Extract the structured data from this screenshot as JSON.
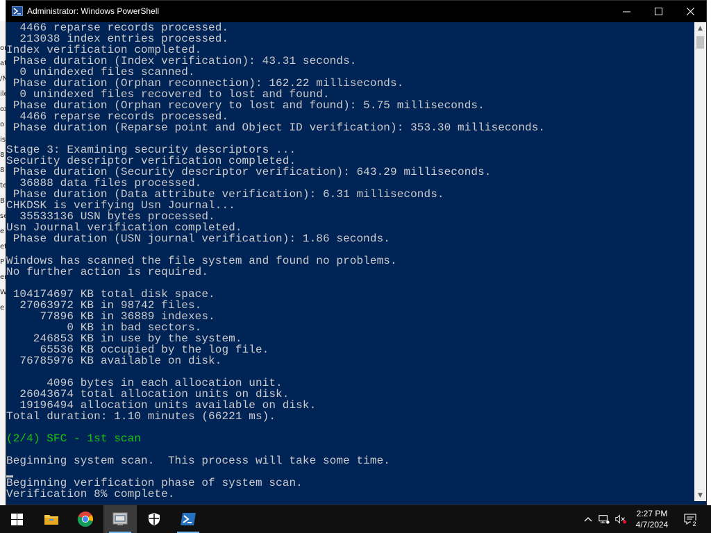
{
  "window": {
    "title": "Administrator: Windows PowerShell"
  },
  "colors": {
    "console_background": "#012456",
    "console_text": "#cccccc",
    "highlight_text": "#16c60c",
    "titlebar": "#000000",
    "taskbar": "#101010"
  },
  "background_window": {
    "fragments": [
      "or",
      "at",
      "/N",
      "ile",
      "ox",
      "o",
      "is",
      "8",
      "8",
      "te",
      "B",
      "se",
      "e",
      "et",
      "P",
      "er",
      "W",
      "e"
    ]
  },
  "console": {
    "lines": [
      {
        "text": "  4466 reparse records processed.",
        "style": "normal"
      },
      {
        "text": "  213038 index entries processed.",
        "style": "normal"
      },
      {
        "text": "Index verification completed.",
        "style": "normal"
      },
      {
        "text": " Phase duration (Index verification): 43.31 seconds.",
        "style": "normal"
      },
      {
        "text": "  0 unindexed files scanned.",
        "style": "normal"
      },
      {
        "text": " Phase duration (Orphan reconnection): 162.22 milliseconds.",
        "style": "normal"
      },
      {
        "text": "  0 unindexed files recovered to lost and found.",
        "style": "normal"
      },
      {
        "text": " Phase duration (Orphan recovery to lost and found): 5.75 milliseconds.",
        "style": "normal"
      },
      {
        "text": "  4466 reparse records processed.",
        "style": "normal"
      },
      {
        "text": " Phase duration (Reparse point and Object ID verification): 353.30 milliseconds.",
        "style": "normal"
      },
      {
        "text": "",
        "style": "normal"
      },
      {
        "text": "Stage 3: Examining security descriptors ...",
        "style": "normal"
      },
      {
        "text": "Security descriptor verification completed.",
        "style": "normal"
      },
      {
        "text": " Phase duration (Security descriptor verification): 643.29 milliseconds.",
        "style": "normal"
      },
      {
        "text": "  36888 data files processed.",
        "style": "normal"
      },
      {
        "text": " Phase duration (Data attribute verification): 6.31 milliseconds.",
        "style": "normal"
      },
      {
        "text": "CHKDSK is verifying Usn Journal...",
        "style": "normal"
      },
      {
        "text": "  35533136 USN bytes processed.",
        "style": "normal"
      },
      {
        "text": "Usn Journal verification completed.",
        "style": "normal"
      },
      {
        "text": " Phase duration (USN journal verification): 1.86 seconds.",
        "style": "normal"
      },
      {
        "text": "",
        "style": "normal"
      },
      {
        "text": "Windows has scanned the file system and found no problems.",
        "style": "normal"
      },
      {
        "text": "No further action is required.",
        "style": "normal"
      },
      {
        "text": "",
        "style": "normal"
      },
      {
        "text": " 104174697 KB total disk space.",
        "style": "normal"
      },
      {
        "text": "  27063972 KB in 98742 files.",
        "style": "normal"
      },
      {
        "text": "     77896 KB in 36889 indexes.",
        "style": "normal"
      },
      {
        "text": "         0 KB in bad sectors.",
        "style": "normal"
      },
      {
        "text": "    246853 KB in use by the system.",
        "style": "normal"
      },
      {
        "text": "     65536 KB occupied by the log file.",
        "style": "normal"
      },
      {
        "text": "  76785976 KB available on disk.",
        "style": "normal"
      },
      {
        "text": "",
        "style": "normal"
      },
      {
        "text": "      4096 bytes in each allocation unit.",
        "style": "normal"
      },
      {
        "text": "  26043674 total allocation units on disk.",
        "style": "normal"
      },
      {
        "text": "  19196494 allocation units available on disk.",
        "style": "normal"
      },
      {
        "text": "Total duration: 1.10 minutes (66221 ms).",
        "style": "normal"
      },
      {
        "text": "",
        "style": "normal"
      },
      {
        "text": "(2/4) SFC - 1st scan",
        "style": "green"
      },
      {
        "text": "",
        "style": "normal"
      },
      {
        "text": "Beginning system scan.  This process will take some time.",
        "style": "normal"
      },
      {
        "text": "",
        "style": "normal"
      },
      {
        "text": "Beginning verification phase of system scan.",
        "style": "normal"
      },
      {
        "text": "Verification 8% complete.",
        "style": "normal"
      }
    ]
  },
  "taskbar": {
    "items": [
      {
        "name": "start-button",
        "icon": "windows-logo-icon",
        "active": false,
        "running": false
      },
      {
        "name": "file-explorer",
        "icon": "folder-icon",
        "active": false,
        "running": false
      },
      {
        "name": "google-chrome",
        "icon": "chrome-icon",
        "active": false,
        "running": false
      },
      {
        "name": "app-window",
        "icon": "app-window-icon",
        "active": true,
        "running": true
      },
      {
        "name": "windows-security",
        "icon": "shield-icon",
        "active": false,
        "running": false
      },
      {
        "name": "powershell",
        "icon": "powershell-icon",
        "active": false,
        "running": true
      }
    ],
    "tray": {
      "icons": [
        "chevron-up-icon",
        "network-icon",
        "volume-muted-icon"
      ],
      "time": "2:27 PM",
      "date": "4/7/2024",
      "notification_count": "2"
    }
  }
}
